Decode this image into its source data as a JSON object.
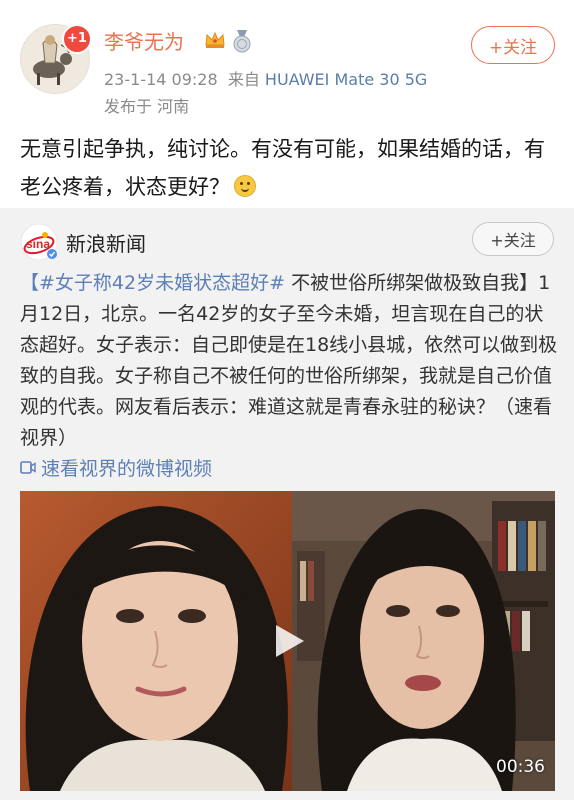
{
  "post": {
    "avatar_badge": "+1",
    "username": "李爷无为",
    "date": "23-1-14 09:28",
    "from_prefix": "来自",
    "device": "HUAWEI Mate 30 5G",
    "location": "发布于 河南",
    "follow_label": "+关注",
    "text": "无意引起争执，纯讨论。有没有可能，如果结婚的话，有老公疼着，状态更好？"
  },
  "repost": {
    "source_name": "新浪新闻",
    "source_logo_text": "sina",
    "follow_label": "+关注",
    "hashtag": "【#女子称42岁未婚状态超好#",
    "body": " 不被世俗所绑架做极致自我】1月12日，北京。一名42岁的女子至今未婚，坦言现在自己的状态超好。女子表示：自己即使是在18线小县城，依然可以做到极致的自我。女子称自己不被任何的世俗所绑架，我就是自己价值观的代表。网友看后表示：难道这就是青春永驻的秘诀？（速看视界）",
    "video_link": "速看视界的微博视频",
    "video_duration": "00:36"
  },
  "colors": {
    "username": "#eb7350",
    "link": "#5d7fb8",
    "repost_bg": "#f2f2f2"
  },
  "icons": [
    "crown-badge-icon",
    "medal-badge-icon",
    "smile-emoji-icon",
    "sina-logo-icon",
    "video-icon",
    "play-icon"
  ]
}
